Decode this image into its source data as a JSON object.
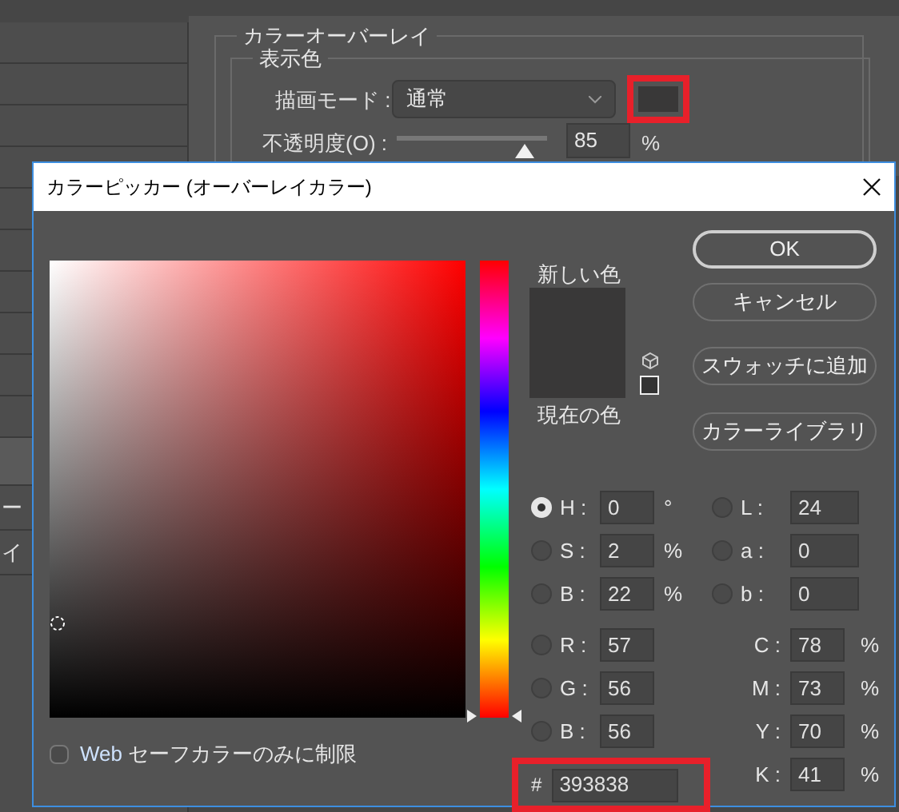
{
  "background": {
    "side_items": [
      "ー",
      "イ"
    ],
    "section_title": "カラーオーバーレイ",
    "group_title": "表示色",
    "blend_label": "描画モード :",
    "blend_value": "通常",
    "opacity_label": "不透明度(O) :",
    "opacity_slider": {
      "level": 0.85
    },
    "opacity_value": "85",
    "opacity_unit": "%"
  },
  "dialog": {
    "title": "カラーピッカー (オーバーレイカラー)",
    "hue_slider": {
      "level": 0
    },
    "new_label": "新しい色",
    "current_label": "現在の色",
    "buttons": [
      {
        "label": "OK",
        "default": true
      },
      {
        "label": "キャンセル",
        "default": false
      },
      {
        "label": "スウォッチに追加",
        "default": false
      },
      {
        "label": "カラーライブラリ",
        "default": false
      }
    ],
    "left_fields": [
      {
        "label": "H :",
        "value": "0",
        "unit": "°",
        "selected": true
      },
      {
        "label": "S :",
        "value": "2",
        "unit": "%",
        "selected": false
      },
      {
        "label": "B :",
        "value": "22",
        "unit": "%",
        "selected": false
      },
      {
        "label": "R :",
        "value": "57",
        "selected": false
      },
      {
        "label": "G :",
        "value": "56",
        "selected": false
      },
      {
        "label": "B :",
        "value": "56",
        "selected": false
      }
    ],
    "right_fields": [
      {
        "kind": "radio",
        "label": "L :",
        "value": "24",
        "selected": false
      },
      {
        "kind": "radio",
        "label": "a :",
        "value": "0",
        "selected": false
      },
      {
        "kind": "radio",
        "label": "b :",
        "value": "0",
        "selected": false
      },
      {
        "kind": "plain",
        "label": "C :",
        "value": "78",
        "unit": "%"
      },
      {
        "kind": "plain",
        "label": "M :",
        "value": "73",
        "unit": "%"
      },
      {
        "kind": "plain",
        "label": "Y :",
        "value": "70",
        "unit": "%"
      },
      {
        "kind": "plain",
        "label": "K :",
        "value": "41",
        "unit": "%"
      }
    ],
    "hex_label": "#",
    "hex_value": "393838",
    "web_safe": {
      "prefix": "Web",
      "label": "セーフカラーのみに制限",
      "checked": false
    }
  }
}
